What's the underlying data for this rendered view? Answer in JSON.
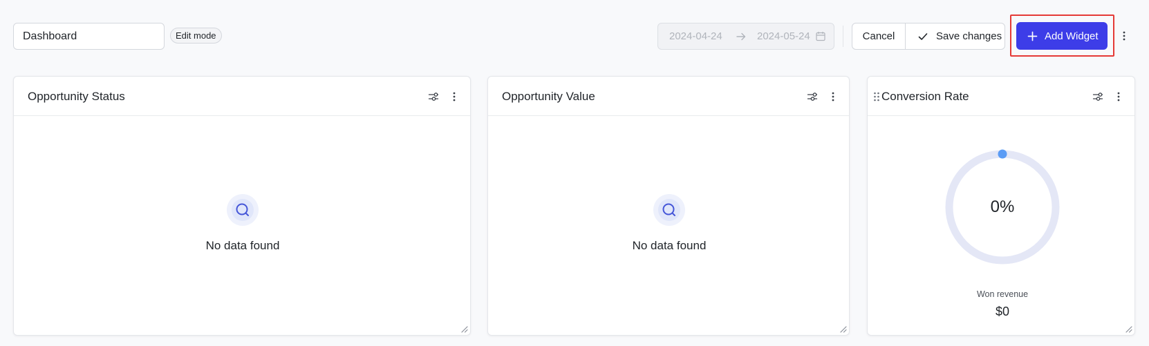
{
  "header": {
    "dashboard_name": "Dashboard",
    "mode_badge": "Edit mode",
    "date_start": "2024-04-24",
    "date_end": "2024-05-24",
    "cancel_label": "Cancel",
    "save_label": "Save changes",
    "add_widget_label": "Add Widget"
  },
  "widgets": [
    {
      "title": "Opportunity Status",
      "empty_text": "No data found"
    },
    {
      "title": "Opportunity Value",
      "empty_text": "No data found"
    },
    {
      "title": "Conversion Rate",
      "gauge_percent": 0,
      "gauge_value": "0%",
      "won_label": "Won revenue",
      "won_value": "$0"
    }
  ],
  "colors": {
    "accent": "#3d3de8",
    "highlight": "#e53935",
    "gauge_track": "#e4e7f6",
    "gauge_dot": "#5b9cf5",
    "empty_icon_bg": "#e6ebfb",
    "empty_icon_stroke": "#4556d8"
  },
  "icons": {
    "date_separator": "arrow-right-icon",
    "date_picker": "calendar-icon",
    "save": "check-icon",
    "add": "plus-icon",
    "more": "more-vertical-icon",
    "widget_settings": "filter-settings-icon",
    "empty_state": "search-icon",
    "resize": "resize-handle-icon",
    "drag": "drag-handle-icon"
  }
}
